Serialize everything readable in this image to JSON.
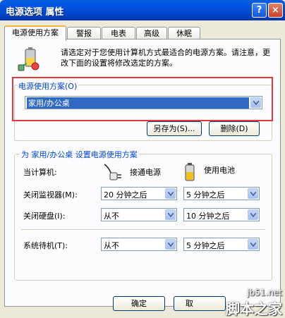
{
  "window": {
    "title": "电源选项 属性",
    "help_label": "?",
    "close_label": "×"
  },
  "tabs": [
    "电源使用方案",
    "警报",
    "电表",
    "高级",
    "休眠"
  ],
  "intro_text": "请选定对于您使用计算机方式最适合的电源方案。请注意，更改下面的设置将修改选定的方案。",
  "scheme_group": {
    "label": "电源使用方案(O)",
    "selected": "家用/办公桌",
    "save_as_label": "另存为(S)...",
    "delete_label": "删除(D)"
  },
  "settings_group": {
    "label": "为 家用/办公桌 设置电源使用方案",
    "computer_label": "当计算机:",
    "col_plugged": "接通电源",
    "col_battery": "使用电池",
    "rows": [
      {
        "label": "关闭监视器(M):",
        "plugged": "20 分钟之后",
        "battery": "5 分钟之后"
      },
      {
        "label": "关闭硬盘(I):",
        "plugged": "从不",
        "battery": "10 分钟之后"
      },
      {
        "label": "系统待机(T):",
        "plugged": "从不",
        "battery": "5 分钟之后"
      }
    ]
  },
  "footer": {
    "ok_label": "确定",
    "cancel_partial": "取"
  },
  "watermark": {
    "line1": "jb51.net",
    "line2": "脚本之家"
  },
  "colors": {
    "title_bar": "#0058e6",
    "highlight": "#e0393e",
    "group_label": "#0046d5",
    "selection": "#316ac5"
  }
}
